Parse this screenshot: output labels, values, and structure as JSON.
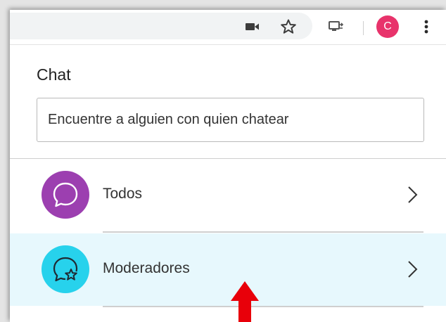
{
  "browser": {
    "icons": [
      "video-camera-icon",
      "bookmark-star-icon",
      "cast-icon",
      "more-vert-icon"
    ],
    "avatar_initial": "C",
    "avatar_color": "#e8336b"
  },
  "chat": {
    "title": "Chat",
    "search": {
      "placeholder": "Encuentre a alguien con quien chatear",
      "value": ""
    },
    "items": [
      {
        "label": "Todos",
        "icon": "chat-bubble-icon",
        "color": "#9c3fb0",
        "highlighted": false
      },
      {
        "label": "Moderadores",
        "icon": "chat-bubble-star-icon",
        "color": "#27d2ec",
        "highlighted": true
      }
    ]
  },
  "annotation": {
    "icon": "red-arrow-pointer-icon",
    "color": "#e8000a"
  }
}
